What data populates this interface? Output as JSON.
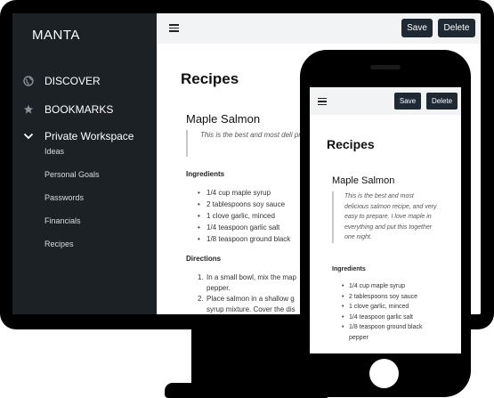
{
  "brand": "MANTA",
  "nav": [
    {
      "label": "DISCOVER",
      "icon": "globe-icon"
    },
    {
      "label": "BOOKMARKS",
      "icon": "star-icon"
    },
    {
      "label": "Private Workspace",
      "icon": "chevron-down-icon"
    }
  ],
  "workspace_items": [
    "Ideas",
    "Personal Goals",
    "Passwords",
    "Financials",
    "Recipes"
  ],
  "toolbar": {
    "save_label": "Save",
    "delete_label": "Delete"
  },
  "page": {
    "title": "Recipes",
    "recipe_title": "Maple Salmon",
    "description_desktop": "This is the best and most deli prepare. I love maple in every",
    "description_phone": "This is the best and most delicious salmon recipe, and very easy to prepare. I love maple in everything and put this together one night.",
    "ingredients_heading": "Ingredients",
    "ingredients": [
      "1/4 cup maple syrup",
      "2 tablespoons soy sauce",
      "1 clove garlic, minced",
      "1/4 teaspoon garlic salt",
      "1/8 teaspoon ground black pepper"
    ],
    "ingredients_desktop_last": "1/8 teaspoon ground black",
    "directions_heading": "Directions",
    "directions": [
      "In a small bowl, mix the map pepper.",
      "Place salmon in a shallow g syrup mixture. Cover the dis"
    ]
  }
}
